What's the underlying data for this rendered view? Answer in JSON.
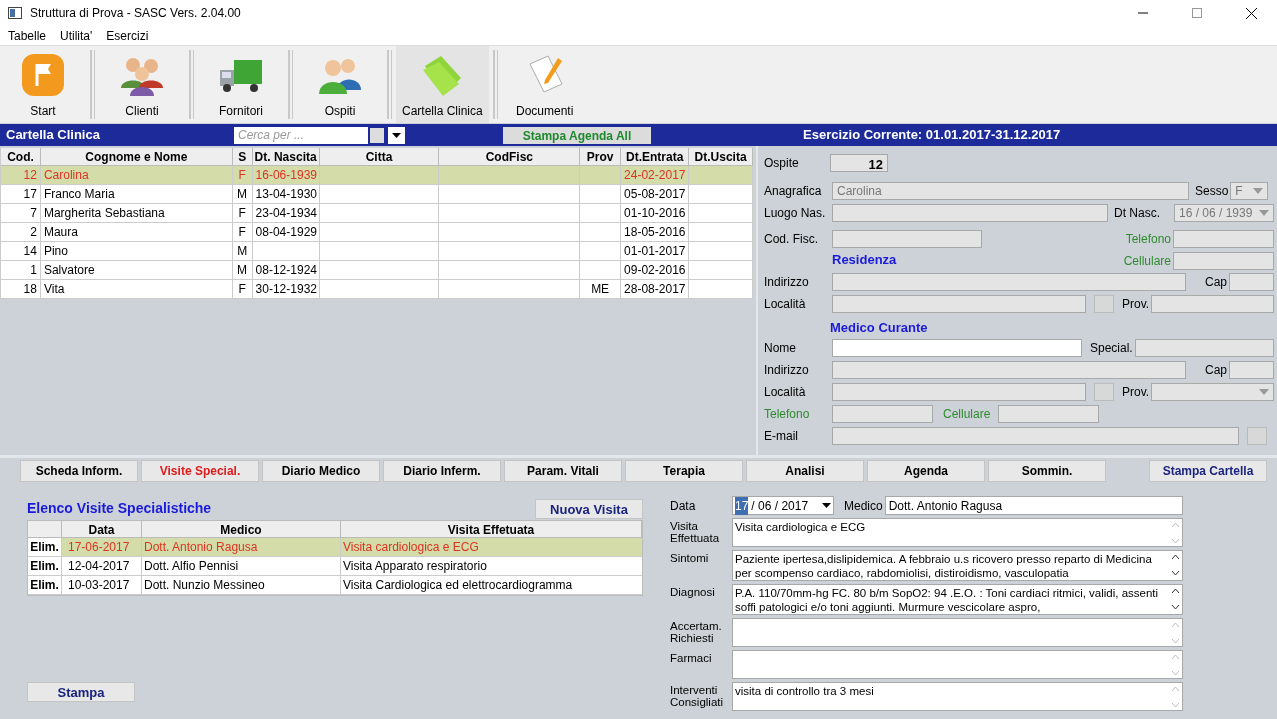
{
  "window": {
    "title": "Struttura di Prova - SASC Vers. 2.04.00"
  },
  "menu": [
    "Tabelle",
    "Utilita'",
    "Esercizi"
  ],
  "toolbar": [
    {
      "kind": "start",
      "label": "Start",
      "selected": false
    },
    {
      "kind": "clients",
      "label": "Clienti",
      "selected": false
    },
    {
      "kind": "truck",
      "label": "Fornitori",
      "selected": false
    },
    {
      "kind": "guests",
      "label": "Ospiti",
      "selected": false
    },
    {
      "kind": "folder",
      "label": "Cartella Clinica",
      "selected": true
    },
    {
      "kind": "document",
      "label": "Documenti",
      "selected": false
    }
  ],
  "header": {
    "title": "Cartella Clinica",
    "search": {
      "placeholder": "Cerca per ..."
    },
    "filter_checkbox": {
      "checked": false
    },
    "print_button": "Stampa Agenda All",
    "exercise": "Esercizio Corrente: 01.01.2017-31.12.2017"
  },
  "guests_table": {
    "columns": [
      "Cod.",
      "Cognome e Nome",
      "S",
      "Dt. Nascita",
      "Citta",
      "CodFisc",
      "Prov",
      "Dt.Entrata",
      "Dt.Uscita"
    ],
    "rows": [
      {
        "cod": "12",
        "name": "Carolina",
        "sex": "F",
        "birth_date": "16-06-1939",
        "entry_date": "24-02-2017",
        "selected": true
      },
      {
        "cod": "17",
        "name": "Franco Maria",
        "sex": "M",
        "birth_date": "13-04-1930",
        "entry_date": "05-08-2017",
        "selected": false
      },
      {
        "cod": "7",
        "name": "Margherita Sebastiana",
        "sex": "F",
        "birth_date": "23-04-1934",
        "entry_date": "01-10-2016",
        "selected": false
      },
      {
        "cod": "2",
        "name": "Maura",
        "sex": "F",
        "birth_date": "08-04-1929",
        "entry_date": "18-05-2016",
        "selected": false
      },
      {
        "cod": "14",
        "name": "Pino",
        "sex": "M",
        "entry_date": "01-01-2017",
        "selected": false
      },
      {
        "cod": "1",
        "name": "Salvatore",
        "sex": "M",
        "birth_date": "08-12-1924",
        "entry_date": "09-02-2016",
        "selected": false
      },
      {
        "cod": "18",
        "name": "Vita",
        "sex": "F",
        "birth_date": "30-12-1932",
        "prov": "ME",
        "entry_date": "28-08-2017",
        "selected": false
      }
    ]
  },
  "guest_form": {
    "ospite": {
      "label": "Ospite",
      "value": "12"
    },
    "anagrafica": {
      "label": "Anagrafica",
      "value": "Carolina",
      "disabled": true
    },
    "sesso": {
      "label": "Sesso",
      "value": "F",
      "disabled": true
    },
    "luogo_nascita": {
      "label": "Luogo Nas.",
      "disabled": true
    },
    "data_nascita": {
      "label": "Dt Nasc.",
      "value": "16 / 06 / 1939",
      "disabled": true
    },
    "codice_fiscale": {
      "label": "Cod. Fisc.",
      "disabled": true
    },
    "telefono": {
      "label": "Telefono",
      "color": "#2e8b2e",
      "disabled": true
    },
    "cellulare": {
      "label": "Cellulare",
      "color": "#2e8b2e",
      "disabled": true
    },
    "residenza": {
      "title": "Residenza",
      "indirizzo": {
        "label": "Indirizzo",
        "disabled": true
      },
      "cap": {
        "label": "Cap",
        "disabled": true
      },
      "localita": {
        "label": "Località",
        "disabled": true
      },
      "prov": {
        "label": "Prov.",
        "disabled": true
      }
    },
    "medico": {
      "title": "Medico Curante",
      "nome": {
        "label": "Nome",
        "disabled": false
      },
      "special": {
        "label": "Special.",
        "disabled": true
      },
      "indirizzo": {
        "label": "Indirizzo",
        "disabled": true
      },
      "cap": {
        "label": "Cap",
        "disabled": true
      },
      "localita": {
        "label": "Località",
        "disabled": true
      },
      "prov": {
        "label": "Prov.",
        "disabled": true
      },
      "telefono": {
        "label": "Telefono",
        "color": "#2e8b2e",
        "disabled": true
      },
      "cellulare": {
        "label": "Cellulare",
        "color": "#2e8b2e",
        "disabled": true
      },
      "email": {
        "label": "E-mail",
        "disabled": true
      }
    }
  },
  "tabs": [
    {
      "label": "Scheda Inform.",
      "selected": false
    },
    {
      "label": "Visite Special.",
      "selected": true
    },
    {
      "label": "Diario Medico",
      "selected": false
    },
    {
      "label": "Diario Inferm.",
      "selected": false
    },
    {
      "label": "Param. Vitali",
      "selected": false
    },
    {
      "label": "Terapia",
      "selected": false
    },
    {
      "label": "Analisi",
      "selected": false
    },
    {
      "label": "Agenda",
      "selected": false
    },
    {
      "label": "Sommin.",
      "selected": false
    }
  ],
  "print_record_button": "Stampa Cartella",
  "visits": {
    "title": "Elenco Visite Specialistiche",
    "new_button": "Nuova Visita",
    "columns": [
      "Data",
      "Medico",
      "Visita Effetuata"
    ],
    "rows": [
      {
        "delete": "Elim.",
        "date": "17-06-2017",
        "doctor": "Dott. Antonio Ragusa",
        "visit": "Visita cardiologica e ECG",
        "selected": true
      },
      {
        "delete": "Elim.",
        "date": "12-04-2017",
        "doctor": "Dott. Alfio Pennisi",
        "visit": "Visita Apparato respiratorio",
        "selected": false
      },
      {
        "delete": "Elim.",
        "date": "10-03-2017",
        "doctor": "Dott. Nunzio Messineo",
        "visit": "Visita Cardiologica ed elettrocardiogramma",
        "selected": false
      }
    ],
    "print_button": "Stampa"
  },
  "visit_detail": {
    "date": {
      "label": "Data",
      "day": "17",
      "rest": "/ 06 / 2017"
    },
    "doctor": {
      "label": "Medico",
      "value": "Dott. Antonio Ragusa"
    },
    "fields": [
      {
        "label": "Visita Effettuata",
        "value": "Visita cardiologica e ECG"
      },
      {
        "label": "Sintomi",
        "value": "Paziente ipertesa,dislipidemica. A febbraio u.s ricovero presso reparto di Medicina per scompenso cardiaco, rabdomiolisi, distiroidismo, vasculopatia"
      },
      {
        "label": "Diagnosi",
        "value": "P.A. 110/70mm-hg FC. 80 b/m SopO2: 94 .E.O. : Toni cardiaci ritmici, validi, assenti soffi patologici e/o toni aggiunti. Murmure vescicolare aspro,"
      },
      {
        "label": "Accertam. Richiesti"
      },
      {
        "label": "Farmaci"
      },
      {
        "label": "Interventi Consigliati",
        "value": "visita di controllo tra 3 mesi"
      }
    ]
  }
}
